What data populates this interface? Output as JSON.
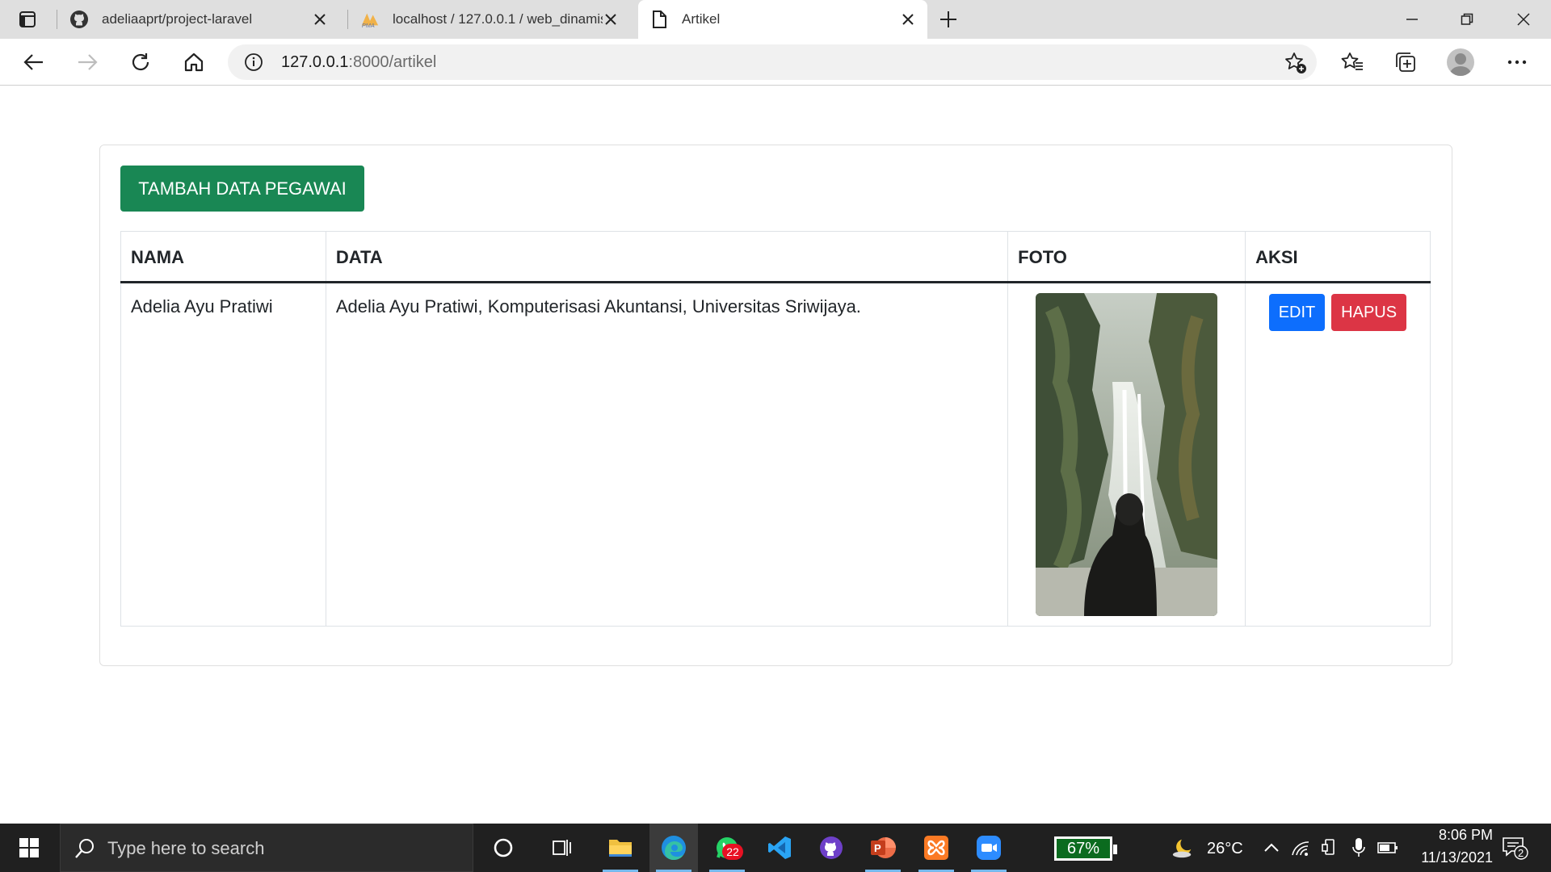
{
  "browser": {
    "tabs": [
      {
        "title": "adeliaaprt/project-laravel",
        "icon": "github-icon"
      },
      {
        "title": "localhost / 127.0.0.1 / web_dinamis",
        "icon": "phpmyadmin-icon"
      },
      {
        "title": "Artikel",
        "icon": "page-icon",
        "active": true
      }
    ],
    "address": {
      "host": "127.0.0.1",
      "path": ":8000/artikel"
    }
  },
  "page": {
    "add_button_label": "TAMBAH DATA PEGAWAI",
    "table": {
      "headers": [
        "NAMA",
        "DATA",
        "FOTO",
        "AKSI"
      ],
      "rows": [
        {
          "nama": "Adelia Ayu Pratiwi",
          "data": "Adelia Ayu Pratiwi, Komputerisasi Akuntansi, Universitas Sriwijaya.",
          "foto": "waterfall-photo",
          "edit_label": "EDIT",
          "hapus_label": "HAPUS"
        }
      ]
    },
    "colors": {
      "add": "#198754",
      "edit": "#0d6efd",
      "hapus": "#dc3545"
    }
  },
  "taskbar": {
    "search_placeholder": "Type here to search",
    "whatsapp_badge": "22",
    "battery": "67%",
    "weather": "26°C",
    "time": "8:06 PM",
    "date": "11/13/2021",
    "notifications": "2"
  }
}
